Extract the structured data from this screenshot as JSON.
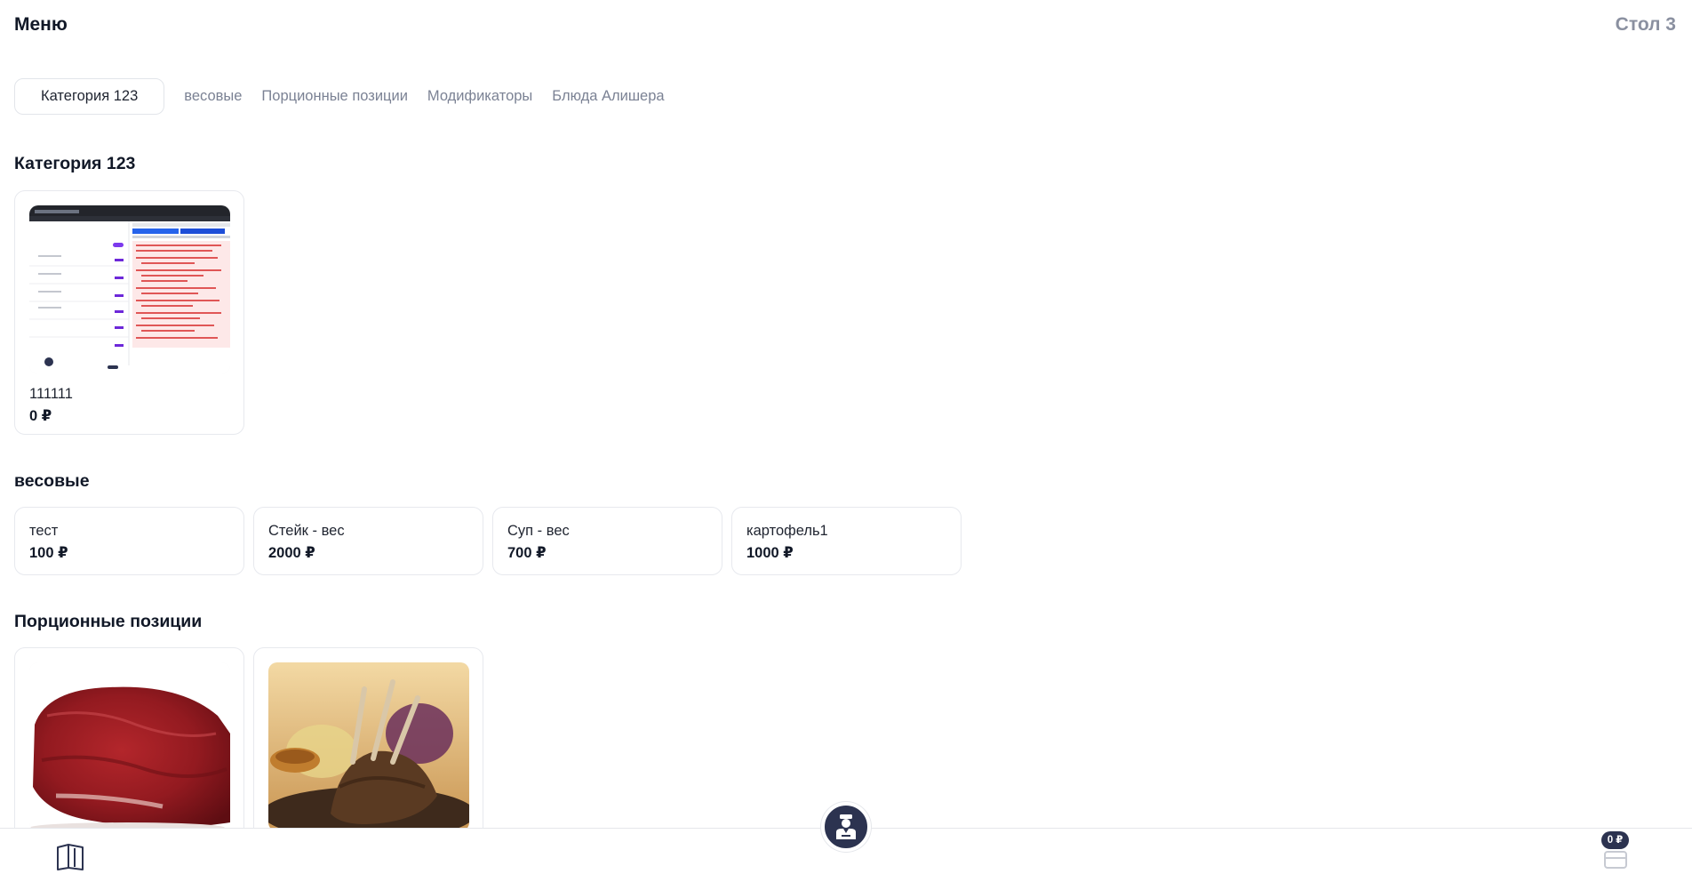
{
  "header": {
    "title": "Меню",
    "table": "Стол 3"
  },
  "tabs": [
    {
      "label": "Категория 123",
      "active": true
    },
    {
      "label": "весовые",
      "active": false
    },
    {
      "label": "Порционные позиции",
      "active": false
    },
    {
      "label": "Модификаторы",
      "active": false
    },
    {
      "label": "Блюда Алишера",
      "active": false
    }
  ],
  "sections": [
    {
      "title": "Категория 123",
      "items": [
        {
          "name": "111111",
          "price": "0 ₽",
          "image": "screenshot-thumbnail"
        }
      ]
    },
    {
      "title": "весовые",
      "items": [
        {
          "name": "тест",
          "price": "100 ₽"
        },
        {
          "name": "Стейк - вес",
          "price": "2000 ₽"
        },
        {
          "name": "Суп - вес",
          "price": "700 ₽"
        },
        {
          "name": "картофель1",
          "price": "1000 ₽"
        }
      ]
    },
    {
      "title": "Порционные позиции",
      "items": [
        {
          "image": "raw-beef-photo"
        },
        {
          "image": "grilled-lamb-ribs-photo"
        }
      ]
    }
  ],
  "bottom_bar": {
    "book_icon": "open-book-icon",
    "waiter_icon": "waiter-icon",
    "cart_icon": "cart-icon",
    "cart_total": "0 ₽"
  },
  "colors": {
    "accent": "#2c3350",
    "muted_text": "#7b8294",
    "border": "#e7e9ee"
  }
}
